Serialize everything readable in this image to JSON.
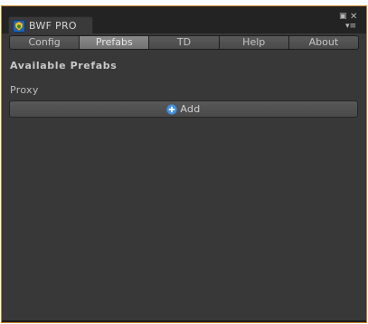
{
  "window": {
    "title": "BWF PRO",
    "app_icon": "bwf-logo-icon",
    "controls": {
      "maximize_icon": "maximize-icon",
      "close_icon": "close-icon",
      "menu_icon": "menu-icon"
    }
  },
  "toolbar": {
    "tabs": [
      {
        "label": "Config",
        "active": false
      },
      {
        "label": "Prefabs",
        "active": true
      },
      {
        "label": "TD",
        "active": false
      },
      {
        "label": "Help",
        "active": false
      },
      {
        "label": "About",
        "active": false
      }
    ]
  },
  "main": {
    "section_title": "Available Prefabs",
    "group_label": "Proxy",
    "add_button": {
      "label": "Add",
      "icon": "plus-circle-icon",
      "icon_color": "#3d8fe0"
    }
  },
  "colors": {
    "focus_border": "#c7852b",
    "panel_background": "#383838",
    "active_tab": "#7d7d7d"
  }
}
